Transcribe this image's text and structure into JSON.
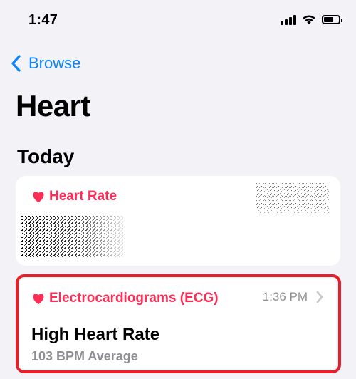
{
  "status_bar": {
    "time": "1:47",
    "icons": [
      "signal-icon",
      "wifi-icon",
      "battery-icon"
    ],
    "battery_level": 0.65
  },
  "nav": {
    "back_label": "Browse"
  },
  "page": {
    "title": "Heart"
  },
  "sections": {
    "today_title": "Today"
  },
  "cards": {
    "heart_rate": {
      "title": "Heart Rate",
      "icon": "heart-icon",
      "accent": "#ff2d55"
    },
    "ecg": {
      "title": "Electrocardiograms (ECG)",
      "time": "1:36 PM",
      "headline": "High Heart Rate",
      "subtitle": "103 BPM Average",
      "icon": "heart-icon"
    }
  },
  "colors": {
    "background": "#f2f2f7",
    "link": "#0a84ff",
    "accent": "#ff2d55",
    "secondary_text": "#8e8e93",
    "highlight_border": "#e5202b"
  }
}
